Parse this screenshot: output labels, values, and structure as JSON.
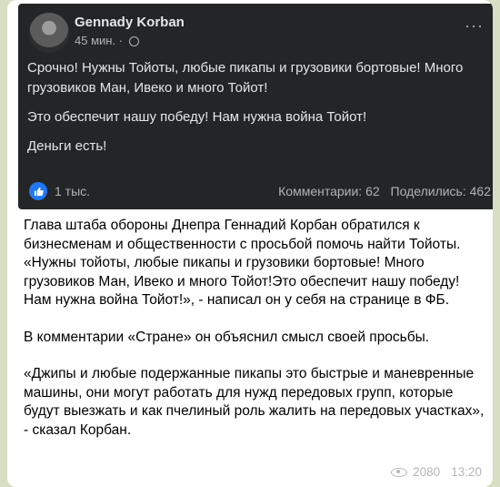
{
  "colors": {
    "chat_background": "#d6dfc4",
    "bubble": "#ffffff",
    "fb_card": "#242526",
    "fb_text": "#e4e6eb",
    "fb_meta": "#b0b3b8",
    "like_blue": "#2078f4"
  },
  "fb_post": {
    "author": "Gennady Korban",
    "time": "45 мин. ·",
    "paragraphs": [
      "Срочно! Нужны Тойоты, любые пикапы и грузовики бортовые! Много грузовиков Ман, Ивеко и много Тойот!",
      "Это обеспечит нашу победу! Нам нужна война Тойот!",
      "Деньги есть!"
    ],
    "likes": "1 тыс.",
    "comments": "Комментарии: 62",
    "shares": "Поделились: 462"
  },
  "message": {
    "paragraphs": [
      "Глава штаба обороны Днепра Геннадий Корбан обратился к бизнесменам и общественности с просьбой помочь найти Тойоты. «Нужны тойоты, любые пикапы и грузовики бортовые! Много грузовиков Ман, Ивеко и много Тойот!Это обеспечит нашу победу! Нам нужна война Тойот!», - написал он у себя на странице в ФБ.",
      "В комментарии «Стране» он объяснил смысл своей просьбы.",
      "«Джипы и любые подержанные  пикапы это быстрые и маневренные машины, они могут работать для нужд передовых групп, которые будут выезжать и как пчелиный роль жалить на передовых участках», - сказал Корбан."
    ],
    "views": "2080",
    "time": "13:20"
  }
}
